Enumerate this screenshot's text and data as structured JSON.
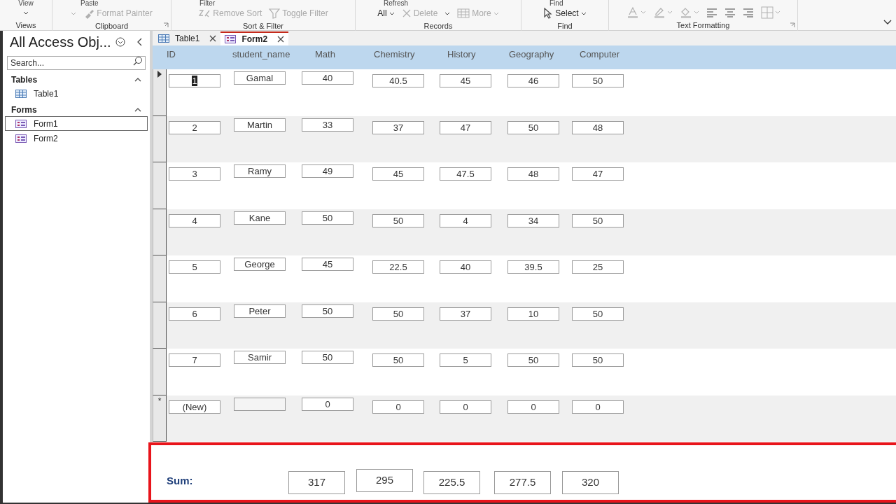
{
  "ribbon": {
    "groups": [
      {
        "label": "Views",
        "top": "View",
        "launcher": false,
        "items": [
          {
            "kind": "caret",
            "disabled": false
          }
        ]
      },
      {
        "label": "Clipboard",
        "top": "Paste",
        "launcher": true,
        "items": [
          {
            "kind": "caret",
            "disabled": true
          },
          {
            "kind": "brush",
            "label": "Format Painter",
            "disabled": true
          }
        ]
      },
      {
        "label": "Sort & Filter",
        "top": "Filter",
        "launcher": false,
        "items": [
          {
            "kind": "sort",
            "label": "Remove Sort",
            "disabled": true
          },
          {
            "kind": "filter",
            "label": "Toggle Filter",
            "disabled": true
          }
        ]
      },
      {
        "label": "Records",
        "top": "Refresh",
        "launcher": false,
        "items": [
          {
            "kind": "dropdown",
            "label": "All",
            "disabled": false
          },
          {
            "kind": "delete",
            "label": "Delete",
            "disabled": true
          },
          {
            "kind": "caret",
            "disabled": false
          },
          {
            "kind": "more",
            "label": "More",
            "disabled": true
          }
        ]
      },
      {
        "label": "Find",
        "top": "Find",
        "launcher": false,
        "items": [
          {
            "kind": "select",
            "label": "Select",
            "disabled": false
          }
        ]
      },
      {
        "label": "Text Formatting",
        "launcher": true,
        "items": [
          {
            "kind": "font-color",
            "disabled": true
          },
          {
            "kind": "highlight",
            "disabled": true
          },
          {
            "kind": "fill",
            "disabled": true
          },
          {
            "kind": "align-left",
            "disabled": false
          },
          {
            "kind": "align-center",
            "disabled": false
          },
          {
            "kind": "align-right",
            "disabled": false
          },
          {
            "kind": "gridlines",
            "disabled": true
          }
        ]
      }
    ]
  },
  "nav": {
    "title": "All Access Obj...",
    "search": {
      "placeholder": "Search..."
    },
    "groups": [
      {
        "label": "Tables",
        "expanded": true,
        "items": [
          {
            "label": "Table1",
            "kind": "table",
            "selected": false
          }
        ]
      },
      {
        "label": "Forms",
        "expanded": true,
        "items": [
          {
            "label": "Form1",
            "kind": "form",
            "selected": true
          },
          {
            "label": "Form2",
            "kind": "form",
            "selected": false
          }
        ]
      }
    ]
  },
  "tabs": [
    {
      "label": "Table1",
      "kind": "table",
      "selected": false
    },
    {
      "label": "Form2",
      "kind": "form",
      "selected": true
    }
  ],
  "form": {
    "columns": [
      "ID",
      "student_name",
      "Math",
      "Chemistry",
      "History",
      "Geography",
      "Computer"
    ],
    "rows": [
      {
        "kind": "record",
        "selected": true,
        "cells": [
          "1",
          "Gamal",
          "40",
          "40.5",
          "45",
          "46",
          "50"
        ]
      },
      {
        "kind": "record",
        "selected": false,
        "cells": [
          "2",
          "Martin",
          "33",
          "37",
          "47",
          "50",
          "48"
        ]
      },
      {
        "kind": "record",
        "selected": false,
        "cells": [
          "3",
          "Ramy",
          "49",
          "45",
          "47.5",
          "48",
          "47"
        ]
      },
      {
        "kind": "record",
        "selected": false,
        "cells": [
          "4",
          "Kane",
          "50",
          "50",
          "4",
          "34",
          "50"
        ]
      },
      {
        "kind": "record",
        "selected": false,
        "cells": [
          "5",
          "George",
          "45",
          "22.5",
          "40",
          "39.5",
          "25"
        ]
      },
      {
        "kind": "record",
        "selected": false,
        "cells": [
          "6",
          "Peter",
          "50",
          "50",
          "37",
          "10",
          "50"
        ]
      },
      {
        "kind": "record",
        "selected": false,
        "cells": [
          "7",
          "Samir",
          "50",
          "50",
          "5",
          "50",
          "50"
        ]
      },
      {
        "kind": "new",
        "selected": false,
        "marker": "*",
        "cells": [
          "(New)",
          null,
          "0",
          "0",
          "0",
          "0",
          "0"
        ]
      }
    ],
    "footer": {
      "label": "Sum:",
      "highlighted": true,
      "sums": [
        "317",
        "295",
        "225.5",
        "277.5",
        "320"
      ]
    }
  }
}
